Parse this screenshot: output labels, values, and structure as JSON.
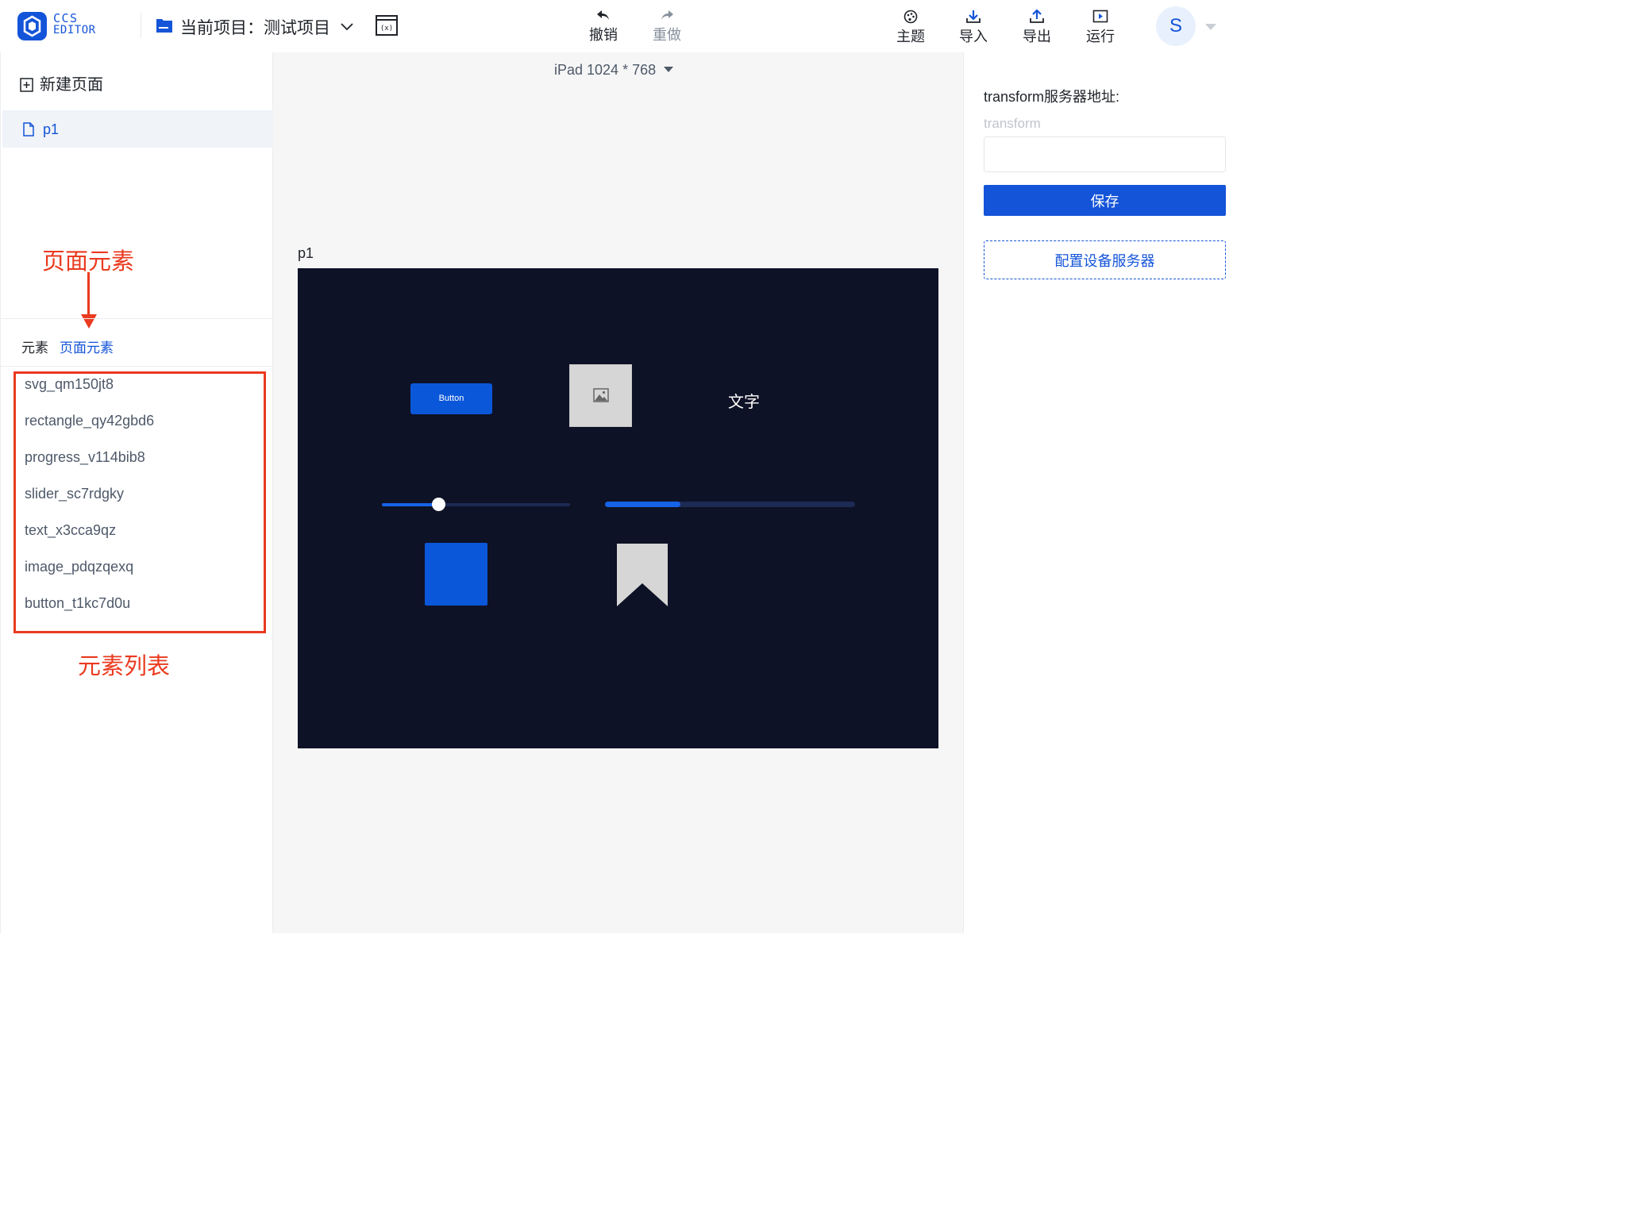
{
  "header": {
    "logo_line1": "CCS",
    "logo_line2": "EDITOR",
    "project_label": "当前项目：测试项目",
    "toolbar": {
      "undo": "撤销",
      "redo": "重做",
      "theme": "主题",
      "import": "导入",
      "export": "导出",
      "run": "运行"
    },
    "avatar_letter": "S"
  },
  "left": {
    "new_page": "新建页面",
    "pages": [
      {
        "label": "p1"
      }
    ],
    "annotation_top": "页面元素",
    "tabs": [
      {
        "label": "元素"
      },
      {
        "label": "页面元素",
        "active": true
      }
    ],
    "elements": [
      "svg_qm150jt8",
      "rectangle_qy42gbd6",
      "progress_v114bib8",
      "slider_sc7rdgky",
      "text_x3cca9qz",
      "image_pdqzqexq",
      "button_t1kc7d0u"
    ],
    "annotation_bottom": "元素列表"
  },
  "center": {
    "device": "iPad 1024 * 768",
    "page_name": "p1",
    "canvas": {
      "button_label": "Button",
      "text_label": "文字",
      "slider_value": 0.3,
      "progress_value": 0.3
    }
  },
  "right": {
    "label": "transform服务器地址:",
    "sub_label": "transform",
    "input_value": "",
    "save_label": "保存",
    "config_label": "配置设备服务器"
  },
  "colors": {
    "accent": "#1454d8",
    "annotation": "#ea3a1f",
    "canvas_bg": "#0e1226"
  }
}
